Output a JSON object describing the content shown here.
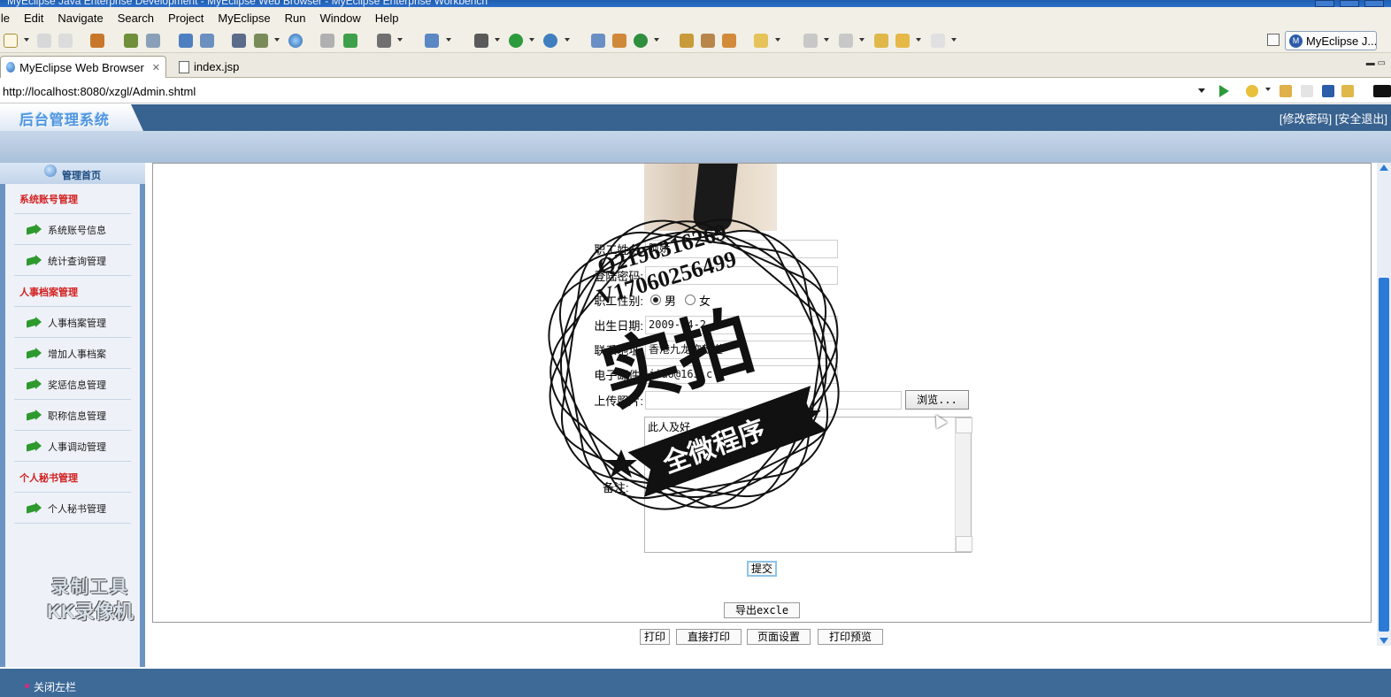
{
  "window": {
    "title": "MyEclipse Java Enterprise Development - MyEclipse Web Browser - MyEclipse Enterprise Workbench"
  },
  "menu": [
    "ile",
    "Edit",
    "Navigate",
    "Search",
    "Project",
    "MyEclipse",
    "Run",
    "Window",
    "Help"
  ],
  "perspective": {
    "label": "MyEclipse J..."
  },
  "tabs": [
    {
      "label": "MyEclipse Web Browser",
      "active": true,
      "icon": "globe-icon"
    },
    {
      "label": "index.jsp",
      "active": false,
      "icon": "jsp-file-icon"
    }
  ],
  "browser": {
    "url": "http://localhost:8080/xzgl/Admin.shtml"
  },
  "app": {
    "logo": "后台管理系统",
    "change_password": "[修改密码]",
    "logout": "[安全退出]",
    "home": "管理首页",
    "close_sidebar": "关闭左栏"
  },
  "sidebar": {
    "items": [
      {
        "label": "系统账号管理",
        "type": "category"
      },
      {
        "label": "系统账号信息",
        "type": "item"
      },
      {
        "label": "统计查询管理",
        "type": "item"
      },
      {
        "label": "人事档案管理",
        "type": "category"
      },
      {
        "label": "人事档案管理",
        "type": "item"
      },
      {
        "label": "增加人事档案",
        "type": "item"
      },
      {
        "label": "奖惩信息管理",
        "type": "item"
      },
      {
        "label": "职称信息管理",
        "type": "item"
      },
      {
        "label": "人事调动管理",
        "type": "item"
      },
      {
        "label": "个人秘书管理",
        "type": "category"
      },
      {
        "label": "个人秘书管理",
        "type": "item"
      }
    ]
  },
  "form": {
    "name": {
      "label": "职工姓名:",
      "value": "阿娇"
    },
    "password": {
      "label": "登陆密码:",
      "value": ""
    },
    "gender": {
      "label": "职工性别:",
      "option_male": "男",
      "option_female": "女"
    },
    "birthday": {
      "label": "出生日期:",
      "value": "2009-04-2"
    },
    "contact": {
      "label": "联系地址:",
      "value": "香港九龙弥敦道"
    },
    "email": {
      "label": "电子邮件:",
      "value": "jiao@163.c"
    },
    "upload": {
      "label": "上传照片:",
      "button": "浏览..."
    },
    "intro": {
      "value": "此人及好"
    },
    "remark": {
      "label": "备注:"
    },
    "submit": "提交",
    "export": "导出excle"
  },
  "print_buttons": [
    "打印",
    "直接打印",
    "页面设置",
    "打印预览"
  ],
  "overlays": {
    "recorder_watermark": [
      "录制工具",
      "KK录像机"
    ],
    "stamp": {
      "qq": "Q2196316269",
      "wechat": "V17060256499",
      "big": "实拍",
      "banner": "全微程序"
    }
  }
}
